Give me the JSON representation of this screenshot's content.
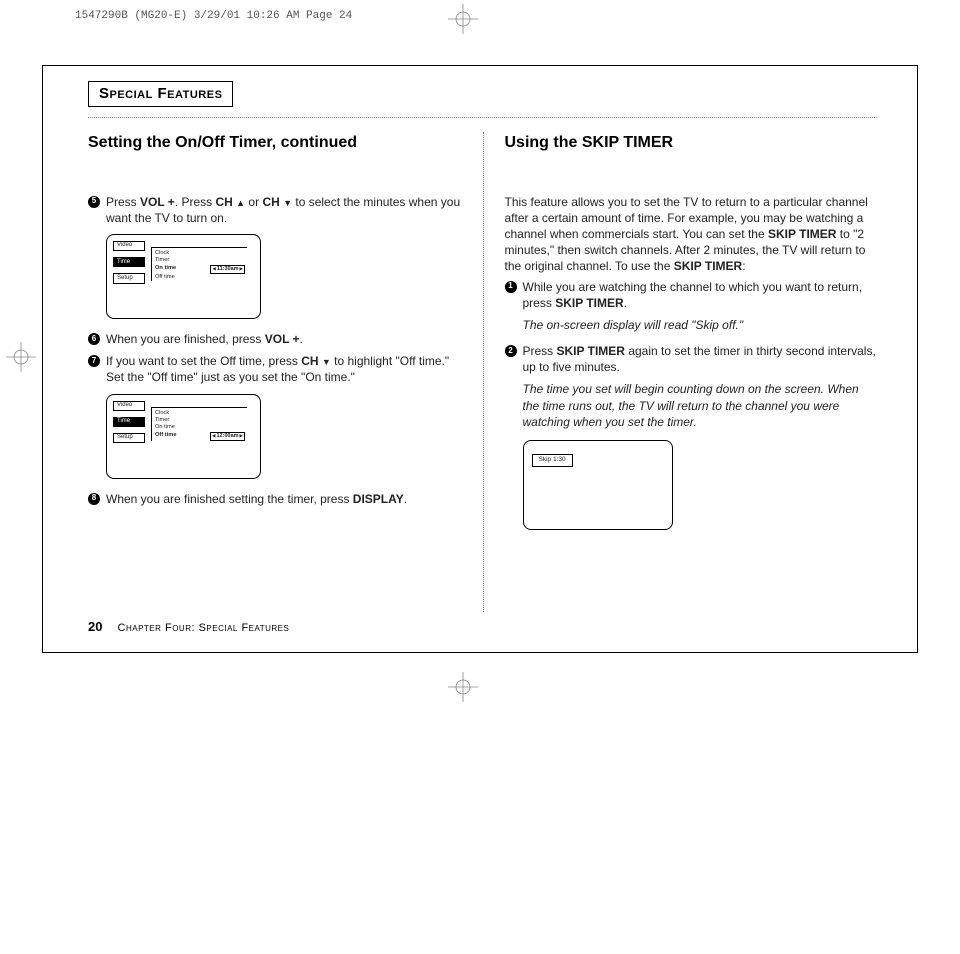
{
  "slug": "1547290B (MG20-E)  3/29/01 10:26 AM  Page 24",
  "section_title": "Special Features",
  "left": {
    "heading": "Setting the On/Off Timer, continued",
    "steps": {
      "s5": {
        "num": "5",
        "pre": "Press ",
        "b1": "VOL +",
        "mid1": ". Press ",
        "b2": "CH ",
        "mid2": " or ",
        "b3": "CH ",
        "post": " to select the minutes when you want the TV to turn on."
      },
      "s6": {
        "num": "6",
        "pre": "When you are finished, press ",
        "b1": "VOL +",
        "post": "."
      },
      "s7": {
        "num": "7",
        "pre": "If you want to set the Off time, press ",
        "b1": "CH ",
        "mid": " to highlight \"Off time.\" Set the \"Off time\" just as you set the \"On time.\""
      },
      "s8": {
        "num": "8",
        "pre": "When you are finished setting the timer, press ",
        "b1": "DISPLAY",
        "post": "."
      }
    },
    "tv1": {
      "tabs": [
        "Video",
        "Time",
        "Setup"
      ],
      "menu": [
        "Clock",
        "Timer"
      ],
      "ontime_label": "On time",
      "ontime_val": "11:30am",
      "offtime_label": "Off time"
    },
    "tv2": {
      "tabs": [
        "Video",
        "Time",
        "Setup"
      ],
      "menu": [
        "Clock",
        "Timer",
        "On time"
      ],
      "offtime_label": "Off time",
      "offtime_val": "12:00am"
    }
  },
  "right": {
    "heading": "Using the SKIP TIMER",
    "intro_pre": "This feature allows you to set the TV to return to a particular channel after a certain amount of time. For example, you may be watching a channel when commercials start. You can set the ",
    "intro_b": "SKIP TIMER",
    "intro_mid": " to \"2 minutes,\" then switch channels. After 2 minutes, the TV will return to the original channel. To use the ",
    "intro_b2": "SKIP TIMER",
    "intro_post": ":",
    "steps": {
      "s1": {
        "num": "1",
        "pre": "While you are watching the channel to which you want to return, press ",
        "b1": "SKIP TIMER",
        "post": ".",
        "ital": "The on-screen display will read \"Skip off.\""
      },
      "s2": {
        "num": "2",
        "pre": "Press ",
        "b1": "SKIP TIMER",
        "post": " again to set the timer in thirty second intervals, up to five minutes.",
        "ital": "The time you set will begin counting down on the screen. When the time runs out, the TV will return to the channel you were watching when you set the timer."
      }
    },
    "skip_display": "Skip    1:30"
  },
  "footer": {
    "page": "20",
    "chapter": "Chapter Four: Special Features"
  }
}
